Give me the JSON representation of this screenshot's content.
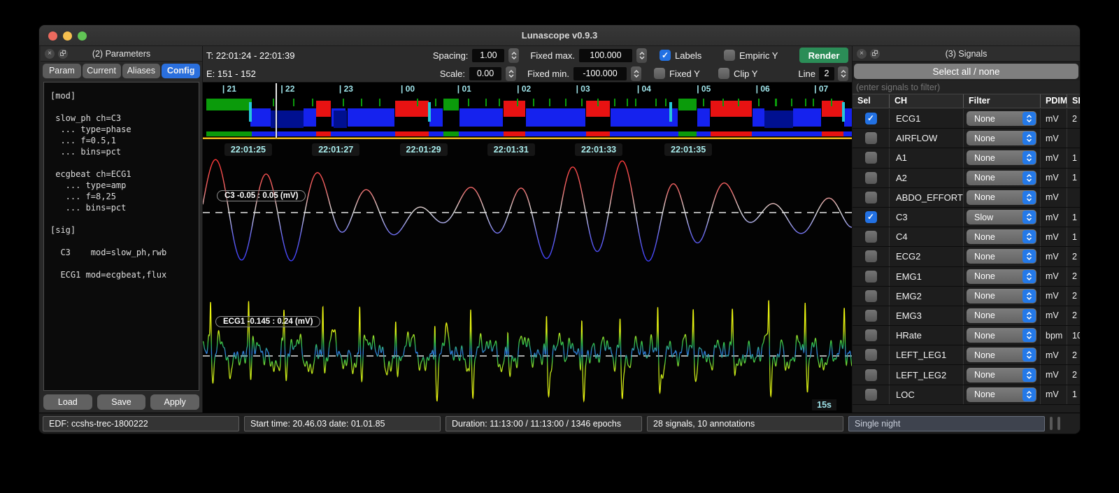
{
  "window": {
    "title": "Lunascope v0.9.3"
  },
  "theme": {
    "accent_blue": "#2271e3",
    "render_green": "#2b8d57",
    "cyan_label": "#9fe4ea",
    "yellow_line": "#edb91f",
    "selected_tab_blue": "#2a6fdd"
  },
  "parameters_panel": {
    "title": "(2) Parameters",
    "tabs": [
      "Param",
      "Current",
      "Aliases",
      "Config"
    ],
    "active_tab": "Config",
    "config_text": "[mod]\n\n slow_ph ch=C3\n  ... type=phase\n  ... f=0.5,1\n  ... bins=pct\n\n ecgbeat ch=ECG1\n   ... type=amp\n   ... f=8,25\n   ... bins=pct\n\n[sig]\n\n  C3    mod=slow_ph,rwb\n\n  ECG1 mod=ecgbeat,flux",
    "buttons": [
      "Load",
      "Save",
      "Apply"
    ]
  },
  "toolbar": {
    "time_range": "T: 22:01:24 - 22:01:39",
    "epoch_range": "E: 151 - 152",
    "spacing_label": "Spacing:",
    "spacing_value": "1.00",
    "scale_label": "Scale:",
    "scale_value": "0.00",
    "fixed_max_label": "Fixed max.",
    "fixed_max_value": "100.000",
    "fixed_min_label": "Fixed min.",
    "fixed_min_value": "-100.000",
    "checkboxes": [
      {
        "label": "Labels",
        "checked": true
      },
      {
        "label": "Empiric Y",
        "checked": false
      },
      {
        "label": "Fixed Y",
        "checked": false
      },
      {
        "label": "Clip Y",
        "checked": false
      }
    ],
    "render_label": "Render",
    "line_label": "Line",
    "line_value": "2"
  },
  "plot": {
    "window_label": "15s"
  },
  "signals_panel": {
    "title": "(3) Signals",
    "select_all_label": "Select all / none",
    "filter_placeholder": "(enter signals to filter)",
    "columns": [
      "Sel",
      "CH",
      "Filter",
      "PDIM",
      "SR"
    ],
    "rows": [
      {
        "sel": true,
        "ch": "ECG1",
        "filter": "None",
        "pdim": "mV",
        "sr": "2"
      },
      {
        "sel": false,
        "ch": "AIRFLOW",
        "filter": "None",
        "pdim": "mV",
        "sr": ""
      },
      {
        "sel": false,
        "ch": "A1",
        "filter": "None",
        "pdim": "mV",
        "sr": "1"
      },
      {
        "sel": false,
        "ch": "A2",
        "filter": "None",
        "pdim": "mV",
        "sr": "1"
      },
      {
        "sel": false,
        "ch": "ABDO_EFFORT",
        "filter": "None",
        "pdim": "mV",
        "sr": ""
      },
      {
        "sel": true,
        "ch": "C3",
        "filter": "Slow",
        "pdim": "mV",
        "sr": "1"
      },
      {
        "sel": false,
        "ch": "C4",
        "filter": "None",
        "pdim": "mV",
        "sr": "1"
      },
      {
        "sel": false,
        "ch": "ECG2",
        "filter": "None",
        "pdim": "mV",
        "sr": "2"
      },
      {
        "sel": false,
        "ch": "EMG1",
        "filter": "None",
        "pdim": "mV",
        "sr": "2"
      },
      {
        "sel": false,
        "ch": "EMG2",
        "filter": "None",
        "pdim": "mV",
        "sr": "2"
      },
      {
        "sel": false,
        "ch": "EMG3",
        "filter": "None",
        "pdim": "mV",
        "sr": "2"
      },
      {
        "sel": false,
        "ch": "HRate",
        "filter": "None",
        "pdim": "bpm",
        "sr": "10"
      },
      {
        "sel": false,
        "ch": "LEFT_LEG1",
        "filter": "None",
        "pdim": "mV",
        "sr": "2"
      },
      {
        "sel": false,
        "ch": "LEFT_LEG2",
        "filter": "None",
        "pdim": "mV",
        "sr": "2"
      },
      {
        "sel": false,
        "ch": "LOC",
        "filter": "None",
        "pdim": "mV",
        "sr": "1"
      }
    ]
  },
  "status_bar": {
    "items": [
      "EDF: ccshs-trec-1800222",
      "Start time: 20.46.03 date: 01.01.85",
      "Duration: 11:13:00 / 11:13:00 / 1346 epochs",
      "28 signals, 10 annotations"
    ],
    "view_mode": "Single night"
  },
  "chart_data": [
    {
      "type": "line",
      "name": "C3",
      "label": "C3 -0.05 : 0.05 (mV)",
      "units": "mV",
      "y_range": [
        -0.05,
        0.05
      ],
      "window_sec": 15,
      "colormap": "rwb (red positive, white zero, blue negative)",
      "synth": {
        "carrier_hz": 0.85,
        "env_hz": 0.12,
        "env_phase": 0.8,
        "env_min": 0.25,
        "env_max": 1.0,
        "secondary": [
          [
            0.33,
            0.18,
            1.3
          ]
        ]
      }
    },
    {
      "type": "line",
      "name": "ECG1",
      "label": "ECG1 -0.145 : 0.24 (mV)",
      "units": "mV",
      "y_range": [
        -0.145,
        0.24
      ],
      "window_sec": 15,
      "colormap": "flux (yellow spikes, green-blue baseline)",
      "synth": {
        "rr_sec": 0.86,
        "t0": 0.18,
        "r_amp": 1.0,
        "s_amp": 0.72,
        "q_amp": 0.14,
        "t_amp": 0.2,
        "noise": [
          [
            1.1,
            0.16,
            0
          ],
          [
            2.7,
            0.13,
            0.9
          ],
          [
            5.3,
            0.1,
            2.1
          ],
          [
            8.9,
            0.07,
            0.3
          ],
          [
            13.7,
            0.05,
            1.7
          ]
        ]
      }
    },
    {
      "type": "hypnogram-band",
      "hours": [
        "| 21",
        "| 22",
        "| 23",
        "| 00",
        "| 01",
        "| 02",
        "| 03",
        "| 04",
        "| 05",
        "| 06",
        "| 07"
      ],
      "hour_x_pct": [
        3.0,
        12.0,
        21.0,
        30.5,
        39.2,
        48.4,
        57.5,
        66.9,
        76.1,
        85.2,
        94.2
      ],
      "cursor_x_pct": 11.2,
      "stage_colors": {
        "wake": "#0b9b0b",
        "rem": "#e81212",
        "nrem": "#1522ee",
        "deep": "#001090",
        "transition": "#25c8d8"
      },
      "wake": [
        [
          0.5,
          7.0
        ],
        [
          37.1,
          2.3
        ],
        [
          73.3,
          2.8
        ]
      ],
      "rem": [
        [
          17.5,
          2.2
        ],
        [
          29.6,
          5.2
        ],
        [
          46.3,
          3.4
        ],
        [
          59.0,
          3.7
        ],
        [
          78.2,
          6.4
        ],
        [
          95.4,
          3.3
        ]
      ],
      "nrem": [
        [
          7.3,
          3.1
        ],
        [
          15.5,
          2.0
        ],
        [
          19.8,
          2.2
        ],
        [
          22.3,
          7.2
        ],
        [
          34.9,
          2.1
        ],
        [
          39.5,
          6.7
        ],
        [
          49.8,
          9.1
        ],
        [
          62.8,
          10.4
        ],
        [
          76.2,
          1.9
        ],
        [
          84.7,
          1.8
        ],
        [
          91.0,
          4.3
        ],
        [
          98.8,
          1.2
        ]
      ],
      "deep": [
        [
          10.4,
          5.1
        ],
        [
          20.1,
          2.1
        ],
        [
          86.5,
          4.5
        ]
      ],
      "transitions": [
        [
          7.1,
          0.4
        ],
        [
          34.7,
          0.4
        ],
        [
          71.9,
          0.4
        ],
        [
          98.5,
          0.4
        ]
      ],
      "arousal_ticks": [
        10.8,
        13.9,
        16.8,
        21.5,
        24.4,
        27.2,
        33.0,
        35.8,
        40.8,
        43.5,
        45.6,
        48.4,
        50.9,
        53.3,
        55.8,
        58.3,
        60.8,
        63.4,
        65.3,
        66.6,
        69.7,
        71.2,
        77.0,
        80.1,
        82.4,
        85.6,
        88.2,
        90.6,
        92.8,
        94.0,
        96.8
      ],
      "strip_base": [
        7.3,
        92.7
      ],
      "time_ticks": [
        [
          "22:01:25",
          7.0
        ],
        [
          "22:01:27",
          20.5
        ],
        [
          "22:01:29",
          34.0
        ],
        [
          "22:01:31",
          47.5
        ],
        [
          "22:01:33",
          61.0
        ],
        [
          "22:01:35",
          74.8
        ]
      ]
    }
  ]
}
